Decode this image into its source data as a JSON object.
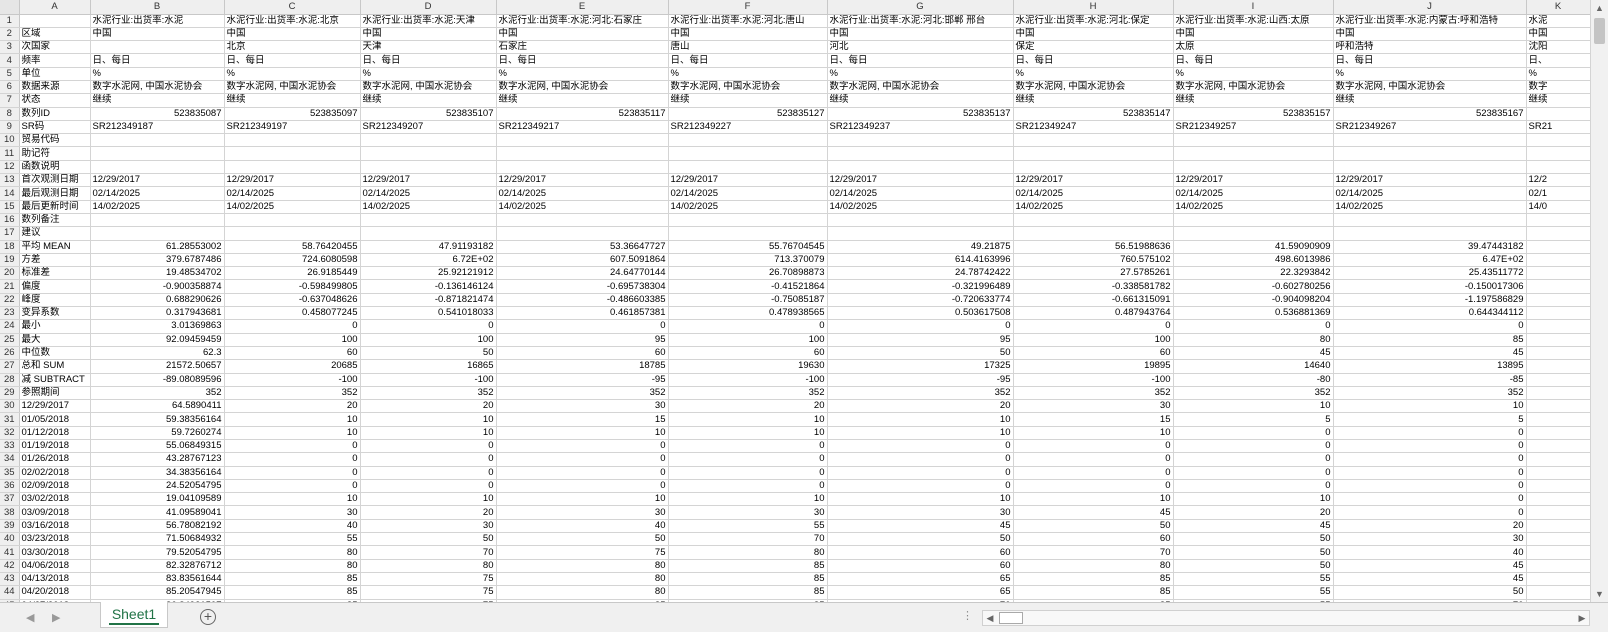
{
  "columns": [
    "A",
    "B",
    "C",
    "D",
    "E",
    "F",
    "G",
    "H",
    "I",
    "J",
    "K"
  ],
  "rows": [
    {
      "n": "1",
      "c": [
        "",
        "水泥行业:出货率:水泥",
        "水泥行业:出货率:水泥:北京",
        "水泥行业:出货率:水泥:天津",
        "水泥行业:出货率:水泥:河北:石家庄",
        "水泥行业:出货率:水泥:河北:唐山",
        "水泥行业:出货率:水泥:河北:邯郸 邢台",
        "水泥行业:出货率:水泥:河北:保定",
        "水泥行业:出货率:水泥:山西:太原",
        "水泥行业:出货率:水泥:内蒙古:呼和浩特",
        "水泥"
      ]
    },
    {
      "n": "2",
      "c": [
        "区域",
        "中国",
        "中国",
        "中国",
        "中国",
        "中国",
        "中国",
        "中国",
        "中国",
        "中国",
        "中国"
      ]
    },
    {
      "n": "3",
      "c": [
        "次国家",
        "",
        "北京",
        "天津",
        "石家庄",
        "唐山",
        "河北",
        "保定",
        "太原",
        "呼和浩特",
        "沈阳"
      ]
    },
    {
      "n": "4",
      "c": [
        "频率",
        "日、每日",
        "日、每日",
        "日、每日",
        "日、每日",
        "日、每日",
        "日、每日",
        "日、每日",
        "日、每日",
        "日、每日",
        "日、"
      ]
    },
    {
      "n": "5",
      "c": [
        "单位",
        "%",
        "%",
        "%",
        "%",
        "%",
        "%",
        "%",
        "%",
        "%",
        "%"
      ]
    },
    {
      "n": "6",
      "c": [
        "数据来源",
        "数字水泥网, 中国水泥协会",
        "数字水泥网, 中国水泥协会",
        "数字水泥网, 中国水泥协会",
        "数字水泥网, 中国水泥协会",
        "数字水泥网, 中国水泥协会",
        "数字水泥网, 中国水泥协会",
        "数字水泥网, 中国水泥协会",
        "数字水泥网, 中国水泥协会",
        "数字水泥网, 中国水泥协会",
        "数字"
      ]
    },
    {
      "n": "7",
      "c": [
        "状态",
        "继续",
        "继续",
        "继续",
        "继续",
        "继续",
        "继续",
        "继续",
        "继续",
        "继续",
        "继续"
      ]
    },
    {
      "n": "8",
      "c": [
        "数列ID",
        "523835087",
        "523835097",
        "523835107",
        "523835117",
        "523835127",
        "523835137",
        "523835147",
        "523835157",
        "523835167",
        ""
      ],
      "num": true
    },
    {
      "n": "9",
      "c": [
        "SR码",
        "SR212349187",
        "SR212349197",
        "SR212349207",
        "SR212349217",
        "SR212349227",
        "SR212349237",
        "SR212349247",
        "SR212349257",
        "SR212349267",
        "SR21"
      ]
    },
    {
      "n": "10",
      "c": [
        "贸易代码",
        "",
        "",
        "",
        "",
        "",
        "",
        "",
        "",
        "",
        ""
      ]
    },
    {
      "n": "11",
      "c": [
        "助记符",
        "",
        "",
        "",
        "",
        "",
        "",
        "",
        "",
        "",
        ""
      ]
    },
    {
      "n": "12",
      "c": [
        "函数说明",
        "",
        "",
        "",
        "",
        "",
        "",
        "",
        "",
        "",
        ""
      ]
    },
    {
      "n": "13",
      "c": [
        "首次观测日期",
        "12/29/2017",
        "12/29/2017",
        "12/29/2017",
        "12/29/2017",
        "12/29/2017",
        "12/29/2017",
        "12/29/2017",
        "12/29/2017",
        "12/29/2017",
        "12/2"
      ]
    },
    {
      "n": "14",
      "c": [
        "最后观测日期",
        "02/14/2025",
        "02/14/2025",
        "02/14/2025",
        "02/14/2025",
        "02/14/2025",
        "02/14/2025",
        "02/14/2025",
        "02/14/2025",
        "02/14/2025",
        "02/1"
      ]
    },
    {
      "n": "15",
      "c": [
        "最后更新时间",
        "14/02/2025",
        "14/02/2025",
        "14/02/2025",
        "14/02/2025",
        "14/02/2025",
        "14/02/2025",
        "14/02/2025",
        "14/02/2025",
        "14/02/2025",
        "14/0"
      ]
    },
    {
      "n": "16",
      "c": [
        "数列备注",
        "",
        "",
        "",
        "",
        "",
        "",
        "",
        "",
        "",
        ""
      ]
    },
    {
      "n": "17",
      "c": [
        "建议",
        "",
        "",
        "",
        "",
        "",
        "",
        "",
        "",
        "",
        ""
      ]
    },
    {
      "n": "18",
      "c": [
        "平均 MEAN",
        "61.28553002",
        "58.76420455",
        "47.91193182",
        "53.36647727",
        "55.76704545",
        "49.21875",
        "56.51988636",
        "41.59090909",
        "39.47443182",
        ""
      ],
      "num": true
    },
    {
      "n": "19",
      "c": [
        "方差",
        "379.6787486",
        "724.6080598",
        "6.72E+02",
        "607.5091864",
        "713.370079",
        "614.4163996",
        "760.575102",
        "498.6013986",
        "6.47E+02",
        ""
      ],
      "num": true
    },
    {
      "n": "20",
      "c": [
        "标准差",
        "19.48534702",
        "26.9185449",
        "25.92121912",
        "24.64770144",
        "26.70898873",
        "24.78742422",
        "27.5785261",
        "22.3293842",
        "25.43511772",
        ""
      ],
      "num": true
    },
    {
      "n": "21",
      "c": [
        "偏度",
        "-0.900358874",
        "-0.598499805",
        "-0.136146124",
        "-0.695738304",
        "-0.41521864",
        "-0.321996489",
        "-0.338581782",
        "-0.602780256",
        "-0.150017306",
        ""
      ],
      "num": true
    },
    {
      "n": "22",
      "c": [
        "峰度",
        "0.688290626",
        "-0.637048626",
        "-0.871821474",
        "-0.486603385",
        "-0.75085187",
        "-0.720633774",
        "-0.661315091",
        "-0.904098204",
        "-1.197586829",
        ""
      ],
      "num": true
    },
    {
      "n": "23",
      "c": [
        "变异系数",
        "0.317943681",
        "0.458077245",
        "0.541018033",
        "0.461857381",
        "0.478938565",
        "0.503617508",
        "0.487943764",
        "0.536881369",
        "0.644344112",
        ""
      ],
      "num": true
    },
    {
      "n": "24",
      "c": [
        "最小",
        "3.01369863",
        "0",
        "0",
        "0",
        "0",
        "0",
        "0",
        "0",
        "0",
        ""
      ],
      "num": true
    },
    {
      "n": "25",
      "c": [
        "最大",
        "92.09459459",
        "100",
        "100",
        "95",
        "100",
        "95",
        "100",
        "80",
        "85",
        ""
      ],
      "num": true
    },
    {
      "n": "26",
      "c": [
        "中位数",
        "62.3",
        "60",
        "50",
        "60",
        "60",
        "50",
        "60",
        "45",
        "45",
        ""
      ],
      "num": true
    },
    {
      "n": "27",
      "c": [
        "总和 SUM",
        "21572.50657",
        "20685",
        "16865",
        "18785",
        "19630",
        "17325",
        "19895",
        "14640",
        "13895",
        ""
      ],
      "num": true
    },
    {
      "n": "28",
      "c": [
        "减 SUBTRACT",
        "-89.08089596",
        "-100",
        "-100",
        "-95",
        "-100",
        "-95",
        "-100",
        "-80",
        "-85",
        ""
      ],
      "num": true
    },
    {
      "n": "29",
      "c": [
        "参照期间",
        "352",
        "352",
        "352",
        "352",
        "352",
        "352",
        "352",
        "352",
        "352",
        ""
      ],
      "num": true
    },
    {
      "n": "30",
      "c": [
        "12/29/2017",
        "64.5890411",
        "20",
        "20",
        "30",
        "20",
        "20",
        "30",
        "10",
        "10",
        ""
      ],
      "num": true
    },
    {
      "n": "31",
      "c": [
        "01/05/2018",
        "59.38356164",
        "10",
        "10",
        "15",
        "10",
        "10",
        "15",
        "5",
        "5",
        ""
      ],
      "num": true
    },
    {
      "n": "32",
      "c": [
        "01/12/2018",
        "59.7260274",
        "10",
        "10",
        "10",
        "10",
        "10",
        "10",
        "0",
        "0",
        ""
      ],
      "num": true
    },
    {
      "n": "33",
      "c": [
        "01/19/2018",
        "55.06849315",
        "0",
        "0",
        "0",
        "0",
        "0",
        "0",
        "0",
        "0",
        ""
      ],
      "num": true
    },
    {
      "n": "34",
      "c": [
        "01/26/2018",
        "43.28767123",
        "0",
        "0",
        "0",
        "0",
        "0",
        "0",
        "0",
        "0",
        ""
      ],
      "num": true
    },
    {
      "n": "35",
      "c": [
        "02/02/2018",
        "34.38356164",
        "0",
        "0",
        "0",
        "0",
        "0",
        "0",
        "0",
        "0",
        ""
      ],
      "num": true
    },
    {
      "n": "36",
      "c": [
        "02/09/2018",
        "24.52054795",
        "0",
        "0",
        "0",
        "0",
        "0",
        "0",
        "0",
        "0",
        ""
      ],
      "num": true
    },
    {
      "n": "37",
      "c": [
        "03/02/2018",
        "19.04109589",
        "10",
        "10",
        "10",
        "10",
        "10",
        "10",
        "10",
        "0",
        ""
      ],
      "num": true
    },
    {
      "n": "38",
      "c": [
        "03/09/2018",
        "41.09589041",
        "30",
        "20",
        "30",
        "30",
        "30",
        "45",
        "20",
        "0",
        ""
      ],
      "num": true
    },
    {
      "n": "39",
      "c": [
        "03/16/2018",
        "56.78082192",
        "40",
        "30",
        "40",
        "55",
        "45",
        "50",
        "45",
        "20",
        ""
      ],
      "num": true
    },
    {
      "n": "40",
      "c": [
        "03/23/2018",
        "71.50684932",
        "55",
        "50",
        "50",
        "70",
        "50",
        "60",
        "50",
        "30",
        ""
      ],
      "num": true
    },
    {
      "n": "41",
      "c": [
        "03/30/2018",
        "79.52054795",
        "80",
        "70",
        "75",
        "80",
        "60",
        "70",
        "50",
        "40",
        ""
      ],
      "num": true
    },
    {
      "n": "42",
      "c": [
        "04/06/2018",
        "82.32876712",
        "80",
        "80",
        "80",
        "85",
        "60",
        "80",
        "50",
        "45",
        ""
      ],
      "num": true
    },
    {
      "n": "43",
      "c": [
        "04/13/2018",
        "83.83561644",
        "85",
        "75",
        "80",
        "85",
        "65",
        "85",
        "55",
        "45",
        ""
      ],
      "num": true
    },
    {
      "n": "44",
      "c": [
        "04/20/2018",
        "85.20547945",
        "85",
        "75",
        "80",
        "85",
        "65",
        "85",
        "55",
        "50",
        ""
      ],
      "num": true
    },
    {
      "n": "45",
      "c": [
        "04/27/2018",
        "86.84931507",
        "85",
        "75",
        "85",
        "85",
        "70",
        "85",
        "55",
        "70",
        ""
      ],
      "num": true
    }
  ],
  "sheet_tab": "Sheet1",
  "icons": {
    "prev": "triangle-left-icon",
    "next": "triangle-right-icon",
    "add": "plus-circle-icon",
    "more": "ellipsis-icon"
  }
}
